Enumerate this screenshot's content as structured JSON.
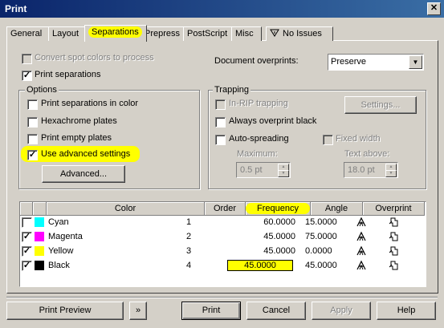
{
  "window": {
    "title": "Print",
    "close_glyph": "✕"
  },
  "tabs": [
    "General",
    "Layout",
    "Separations",
    "Prepress",
    "PostScript",
    "Misc",
    "No Issues"
  ],
  "colors": {
    "highlight": "#ffff00",
    "titlebar": "#0a246a"
  },
  "top": {
    "convert_spot": "Convert spot colors to process",
    "print_separations": "Print separations",
    "doc_overprints_label": "Document overprints:",
    "doc_overprints_value": "Preserve"
  },
  "options": {
    "title": "Options",
    "in_color": "Print separations in color",
    "hexachrome": "Hexachrome plates",
    "empty": "Print empty plates",
    "advanced_settings": "Use advanced settings",
    "advanced_button": "Advanced..."
  },
  "trapping": {
    "title": "Trapping",
    "in_rip": "In-RIP trapping",
    "settings_button": "Settings...",
    "always_overprint": "Always overprint black",
    "auto_spreading": "Auto-spreading",
    "fixed_width": "Fixed width",
    "maximum_label": "Maximum:",
    "maximum_value": "0.5 pt",
    "text_above_label": "Text above:",
    "text_above_value": "18.0 pt"
  },
  "table": {
    "headers": [
      "Color",
      "Order",
      "Frequency",
      "Angle",
      "Overprint"
    ],
    "rows": [
      {
        "checked": false,
        "swatch": "#00ffff",
        "color": "Cyan",
        "order": "1",
        "frequency": "60.0000",
        "angle": "15.0000"
      },
      {
        "checked": true,
        "swatch": "#ff00ff",
        "color": "Magenta",
        "order": "2",
        "frequency": "45.0000",
        "angle": "75.0000"
      },
      {
        "checked": true,
        "swatch": "#ffff00",
        "color": "Yellow",
        "order": "3",
        "frequency": "45.0000",
        "angle": "0.0000"
      },
      {
        "checked": true,
        "swatch": "#000000",
        "color": "Black",
        "order": "4",
        "frequency": "45.0000",
        "angle": "45.0000"
      }
    ]
  },
  "buttons": {
    "print_preview": "Print Preview",
    "expand_glyph": "»",
    "print": "Print",
    "cancel": "Cancel",
    "apply": "Apply",
    "help": "Help"
  },
  "icons": {
    "overprint_text": "text-overprint-icon",
    "overprint_fill": "fill-overprint-icon",
    "warning": "no-issues-icon"
  }
}
